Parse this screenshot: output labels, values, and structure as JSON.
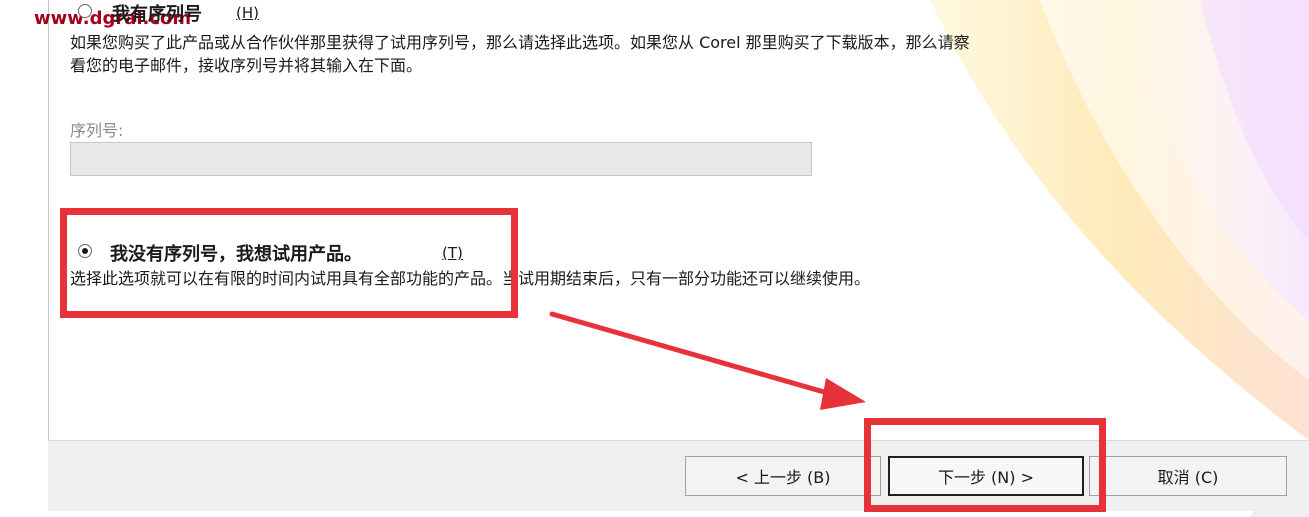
{
  "watermark": "www.dgrai.com",
  "option_has_serial": {
    "title": "我有序列号",
    "accelerator": "(H)",
    "description_line1": "如果您购买了此产品或从合作伙伴那里获得了试用序列号，那么请选择此选项。如果您从 Corel 那里购买了下载版本，那么请察",
    "description_line2": "看您的电子邮件，接收序列号并将其输入在下面。",
    "selected": false
  },
  "serial": {
    "label": "序列号:",
    "value": ""
  },
  "option_trial": {
    "title": "我没有序列号，我想试用产品。",
    "accelerator": "(T)",
    "description": "选择此选项就可以在有限的时间内试用具有全部功能的产品。当试用期结束后，只有一部分功能还可以继续使用。",
    "selected": true
  },
  "buttons": {
    "prev": "< 上一步 (B)",
    "next": "下一步 (N) >",
    "cancel": "取消 (C)"
  },
  "colors": {
    "highlight": "#e8323a",
    "watermark": "#a3001a"
  }
}
